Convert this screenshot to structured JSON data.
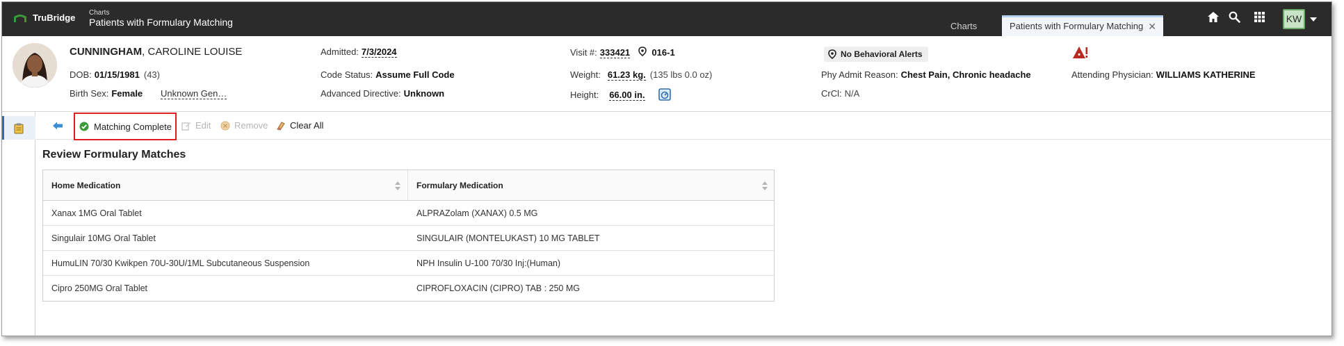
{
  "app": {
    "brand": "TruBridge",
    "breadcrumb_small": "Charts",
    "breadcrumb_title": "Patients with Formulary Matching"
  },
  "tabs": {
    "charts": "Charts",
    "active": "Patients with Formulary Matching"
  },
  "user": {
    "initials": "KW"
  },
  "patient": {
    "last_name": "CUNNINGHAM",
    "first_names": ", CAROLINE LOUISE",
    "dob_label": "DOB:",
    "dob": "01/15/1981",
    "age": "(43)",
    "birth_sex_label": "Birth Sex:",
    "birth_sex": "Female",
    "gender": "Unknown Gen…",
    "admitted_label": "Admitted:",
    "admitted": "7/3/2024",
    "code_status_label": "Code Status:",
    "code_status": "Assume Full Code",
    "adv_dir_label": "Advanced Directive:",
    "adv_dir": "Unknown",
    "visit_label": "Visit #:",
    "visit": "333421",
    "location": "016-1",
    "weight_label": "Weight:",
    "weight": "61.23 kg.",
    "weight_lbs": "(135 lbs 0.0 oz)",
    "height_label": "Height:",
    "height": "66.00 in.",
    "behavior_alert": "No Behavioral Alerts",
    "phy_admit_label": "Phy Admit Reason:",
    "phy_admit": "Chest Pain, Chronic headache",
    "crcl_label": "CrCl:",
    "crcl": "N/A",
    "attending_label": "Attending Physician:",
    "attending": "WILLIAMS KATHERINE"
  },
  "toolbar": {
    "matching_complete": "Matching Complete",
    "edit": "Edit",
    "remove": "Remove",
    "clear_all": "Clear All"
  },
  "review": {
    "title": "Review Formulary Matches",
    "columns": [
      "Home Medication",
      "Formulary Medication"
    ],
    "rows": [
      {
        "home": "Xanax 1MG Oral Tablet",
        "formulary": "ALPRAZolam (XANAX) 0.5 MG"
      },
      {
        "home": "Singulair 10MG Oral Tablet",
        "formulary": "SINGULAIR (MONTELUKAST) 10 MG TABLET"
      },
      {
        "home": "HumuLIN 70/30 Kwikpen 70U-30U/1ML Subcutaneous Suspension",
        "formulary": "NPH Insulin U-100 70/30 Inj:(Human)"
      },
      {
        "home": "Cipro 250MG Oral Tablet",
        "formulary": "CIPROFLOXACIN (CIPRO) TAB : 250 MG"
      }
    ]
  },
  "icons": {
    "home": "home-icon",
    "search": "search-icon",
    "apps": "apps-grid-icon",
    "back": "back-arrow-icon",
    "check": "check-circle-icon",
    "warning": "warning-icon"
  },
  "colors": {
    "topbar": "#2b2b2b",
    "accent_green": "#3a9a3a",
    "highlight_red": "#e02020",
    "alert_red": "#b8281e",
    "link_blue": "#2f6fb3"
  }
}
